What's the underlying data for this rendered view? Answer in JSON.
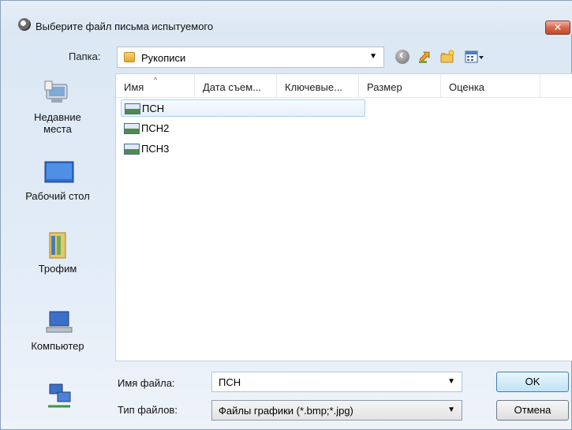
{
  "window": {
    "title": "Выберите файл письма испытуемого",
    "close_label": "✕"
  },
  "folder_bar": {
    "label": "Папка:",
    "current": "Рукописи"
  },
  "toolbar_icons": [
    "back-icon",
    "up-folder-icon",
    "new-folder-icon",
    "views-menu-icon"
  ],
  "places": [
    {
      "label_line1": "Недавние",
      "label_line2": "места",
      "icon": "recent-places-icon"
    },
    {
      "label_line1": "Рабочий стол",
      "label_line2": "",
      "icon": "desktop-icon"
    },
    {
      "label_line1": "Трофим",
      "label_line2": "",
      "icon": "user-folder-icon"
    },
    {
      "label_line1": "Компьютер",
      "label_line2": "",
      "icon": "computer-icon"
    },
    {
      "label_line1": "",
      "label_line2": "",
      "icon": "network-icon"
    }
  ],
  "columns": [
    "Имя",
    "Дата съем...",
    "Ключевые...",
    "Размер",
    "Оценка"
  ],
  "files": [
    {
      "name": "ПСН",
      "selected": true
    },
    {
      "name": "ПСН2",
      "selected": false
    },
    {
      "name": "ПСН3",
      "selected": false
    }
  ],
  "filename": {
    "label": "Имя файла:",
    "value": "ПСН"
  },
  "filetype": {
    "label": "Тип файлов:",
    "value": "Файлы графики (*.bmp;*.jpg)"
  },
  "buttons": {
    "ok": "OK",
    "cancel": "Отмена"
  }
}
